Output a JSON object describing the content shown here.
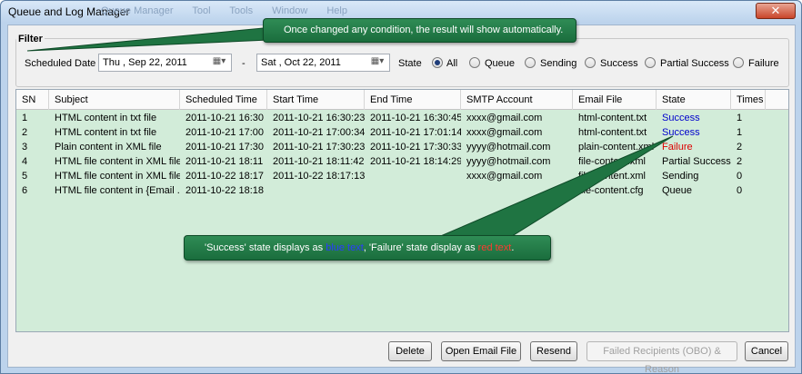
{
  "window": {
    "title": "Queue and Log Manager",
    "ghost_menu": [
      "Queue Manager",
      "Tool",
      "Tools",
      "Window",
      "Help"
    ],
    "close_glyph": "✕"
  },
  "filter": {
    "group_label": "Filter",
    "scheduled_date_label": "Scheduled Date",
    "date_from": "Thu , Sep 22, 2011",
    "date_separator": "-",
    "date_to": "Sat , Oct 22, 2011",
    "state_label": "State",
    "states": [
      {
        "label": "All",
        "selected": true
      },
      {
        "label": "Queue",
        "selected": false
      },
      {
        "label": "Sending",
        "selected": false
      },
      {
        "label": "Success",
        "selected": false
      },
      {
        "label": "Partial Success",
        "selected": false
      },
      {
        "label": "Failure",
        "selected": false
      }
    ]
  },
  "table": {
    "columns": [
      "SN",
      "Subject",
      "Scheduled Time",
      "Start Time",
      "End Time",
      "SMTP Account",
      "Email File",
      "State",
      "Times"
    ],
    "rows": [
      [
        "1",
        "HTML content in txt file",
        "2011-10-21 16:30",
        "2011-10-21 16:30:23",
        "2011-10-21 16:30:45",
        "xxxx@gmail.com",
        "html-content.txt",
        "Success",
        "1"
      ],
      [
        "2",
        "HTML content in txt file",
        "2011-10-21 17:00",
        "2011-10-21 17:00:34",
        "2011-10-21 17:01:14",
        "xxxx@gmail.com",
        "html-content.txt",
        "Success",
        "1"
      ],
      [
        "3",
        "Plain content in XML file",
        "2011-10-21 17:30",
        "2011-10-21 17:30:23",
        "2011-10-21 17:30:33",
        "yyyy@hotmail.com",
        "plain-content.xml",
        "Failure",
        "2"
      ],
      [
        "4",
        "HTML file content in XML file",
        "2011-10-21 18:11",
        "2011-10-21 18:11:42",
        "2011-10-21 18:14:29",
        "yyyy@hotmail.com",
        "file-content.xml",
        "Partial Success",
        "2"
      ],
      [
        "5",
        "HTML file content in XML file",
        "2011-10-22 18:17",
        "2011-10-22 18:17:13",
        "",
        "xxxx@gmail.com",
        "file-content.xml",
        "Sending",
        "0"
      ],
      [
        "6",
        "HTML file content in {Email ...",
        "2011-10-22 18:18",
        "",
        "",
        "",
        "file-content.cfg",
        "Queue",
        "0"
      ]
    ],
    "state_colors": {
      "Success": "#0000cc",
      "Failure": "#dd0000",
      "default": "#000000"
    },
    "row_background": "#d2ecd9"
  },
  "buttons": {
    "delete": "Delete",
    "open_email_file": "Open Email File",
    "resend": "Resend",
    "failed_recipients": "Failed Recipients (OBO) & Reason",
    "cancel": "Cancel"
  },
  "callouts": {
    "top": "Once changed any condition, the result will show automatically.",
    "bottom_prefix": "'Success'  state displays as ",
    "bottom_blue": "blue text",
    "bottom_middle": ", 'Failure' state display as ",
    "bottom_red": "red text",
    "bottom_suffix": "."
  }
}
